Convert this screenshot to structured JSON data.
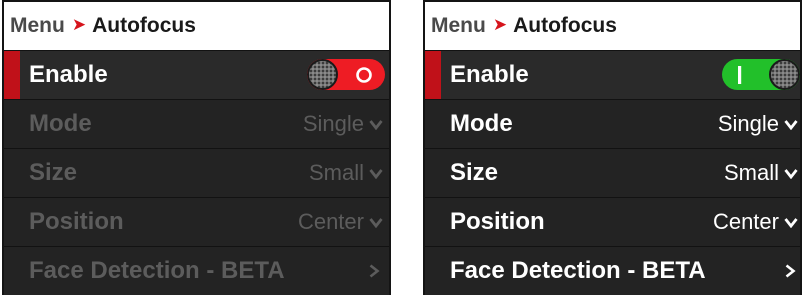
{
  "panels": [
    {
      "breadcrumb": {
        "root": "Menu",
        "current": "Autofocus"
      },
      "toggle_state": "off",
      "toggle_color": "#ee1c24",
      "rows": [
        {
          "label": "Enable"
        },
        {
          "label": "Mode",
          "value": "Single"
        },
        {
          "label": "Size",
          "value": "Small"
        },
        {
          "label": "Position",
          "value": "Center"
        },
        {
          "label": "Face Detection - BETA"
        }
      ]
    },
    {
      "breadcrumb": {
        "root": "Menu",
        "current": "Autofocus"
      },
      "toggle_state": "on",
      "toggle_color": "#22c02a",
      "rows": [
        {
          "label": "Enable"
        },
        {
          "label": "Mode",
          "value": "Single"
        },
        {
          "label": "Size",
          "value": "Small"
        },
        {
          "label": "Position",
          "value": "Center"
        },
        {
          "label": "Face Detection - BETA"
        }
      ]
    }
  ],
  "colors": {
    "selection_bar": "#c01119",
    "disabled_text": "#5c5c5c",
    "breadcrumb_separator": "#d6141c"
  },
  "icons": {
    "breadcrumb_separator": "arrowhead-right",
    "dropdown": "chevron-down-icon",
    "submenu": "chevron-right-icon"
  }
}
